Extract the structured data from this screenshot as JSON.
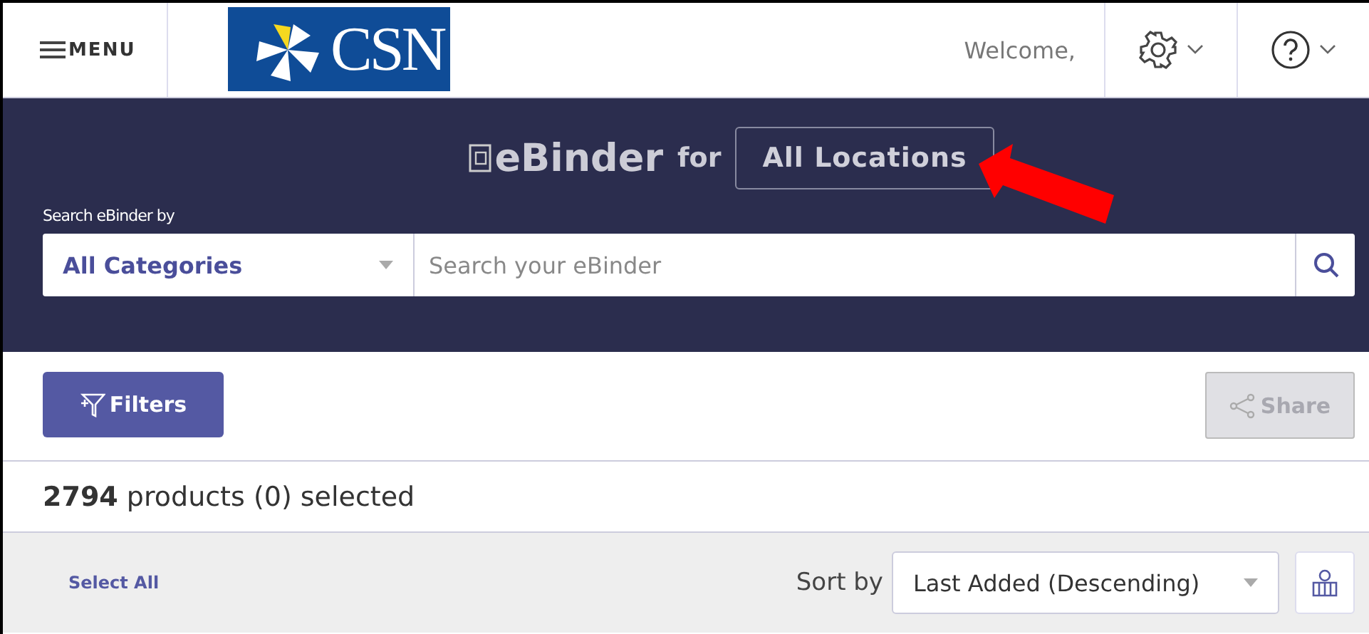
{
  "header": {
    "menu_label": "MENU",
    "logo_text": "CSN",
    "welcome": "Welcome,"
  },
  "banner": {
    "title": "eBinder",
    "for_label": "for",
    "location": "All Locations",
    "search_label": "Search eBinder by",
    "category": "All Categories",
    "search": {
      "placeholder": "Search your eBinder"
    }
  },
  "toolbar": {
    "filters": "Filters",
    "share": {
      "label": "Share",
      "disabled": true
    }
  },
  "summary": "**2794** products (0) selected",
  "list_bar": {
    "select_all": "Select All",
    "sort_label": "Sort by",
    "sort_value": "Last Added (Descending)"
  }
}
